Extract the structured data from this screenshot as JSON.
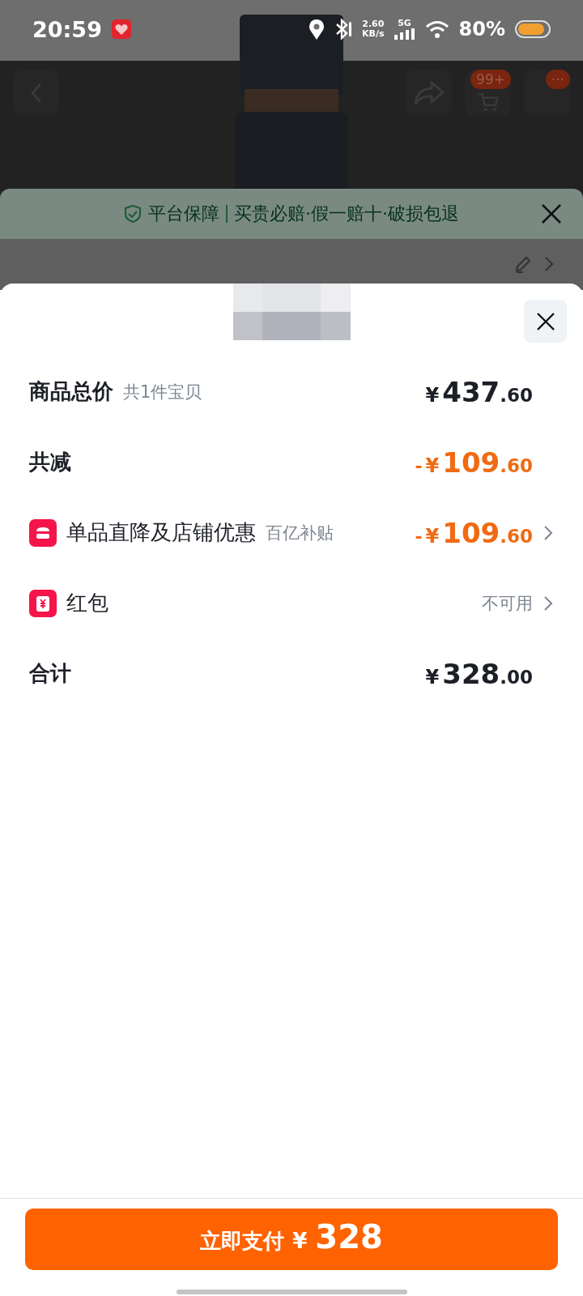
{
  "status_bar": {
    "time": "20:59",
    "speed_value": "2.60",
    "speed_unit": "KB/s",
    "network": "5G",
    "battery": "80%"
  },
  "header": {
    "cart_badge": "99+",
    "more_badge": "···"
  },
  "guarantee_banner": {
    "title": "平台保障",
    "text": "买贵必赔·假一赔十·破损包退"
  },
  "summary_rows": [
    {
      "kind": "plain",
      "label": "商品总价",
      "note": "共1件宝贝",
      "amount": {
        "kind": "normal",
        "currency": "¥",
        "integer": "437",
        "decimal": ".60"
      }
    },
    {
      "kind": "plain",
      "label": "共减",
      "amount": {
        "kind": "discount",
        "sign": "-",
        "currency": "¥",
        "integer": "109",
        "decimal": ".60"
      }
    },
    {
      "kind": "shop",
      "label": "单品直降及店铺优惠",
      "note": "百亿补贴",
      "amount": {
        "kind": "discount",
        "sign": "-",
        "currency": "¥",
        "integer": "109",
        "decimal": ".60"
      }
    },
    {
      "kind": "packet",
      "label": "红包",
      "status": "不可用"
    },
    {
      "kind": "plain",
      "label": "合计",
      "amount": {
        "kind": "normal",
        "currency": "¥",
        "integer": "328",
        "decimal": ".00"
      }
    }
  ],
  "pay_button": {
    "label": "立即支付",
    "currency": "¥",
    "amount": "328"
  }
}
